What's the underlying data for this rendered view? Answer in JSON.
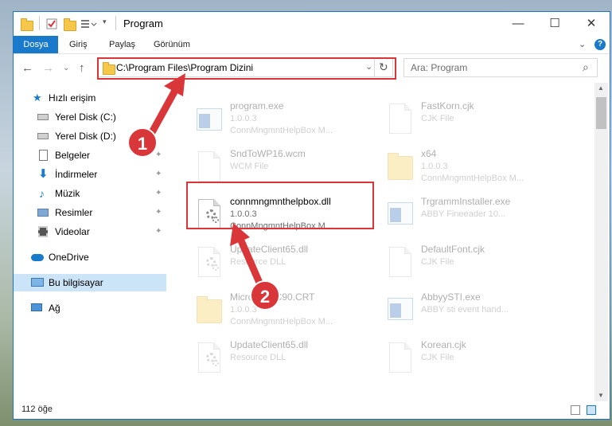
{
  "window": {
    "title": "Program",
    "controls": {
      "minimize": "—",
      "maximize": "☐",
      "close": "✕"
    }
  },
  "ribbon": {
    "tabs": [
      "Dosya",
      "Giriş",
      "Paylaş",
      "Görünüm"
    ],
    "expand": "⌄",
    "help": "?"
  },
  "navigation": {
    "back": "←",
    "forward": "→",
    "recent": "⌄",
    "up": "↑"
  },
  "address_bar": {
    "path": "C:\\Program Files\\Program Dizini",
    "dropdown": "⌄",
    "refresh": "↻"
  },
  "search": {
    "placeholder": "Ara: Program",
    "icon": "⌕"
  },
  "sidebar": {
    "items": [
      {
        "label": "Hızlı erişim",
        "icon": "star-icon"
      },
      {
        "label": "Yerel Disk (C:)",
        "icon": "drive-icon",
        "pinned": true
      },
      {
        "label": "Yerel Disk (D:)",
        "icon": "drive-icon",
        "pinned": true
      },
      {
        "label": "Belgeler",
        "icon": "documents-icon",
        "pinned": true
      },
      {
        "label": "İndirmeler",
        "icon": "download-icon",
        "pinned": true
      },
      {
        "label": "Müzik",
        "icon": "music-icon",
        "pinned": true
      },
      {
        "label": "Resimler",
        "icon": "pictures-icon",
        "pinned": true
      },
      {
        "label": "Videolar",
        "icon": "videos-icon",
        "pinned": true
      },
      {
        "label": "OneDrive",
        "icon": "cloud-icon"
      },
      {
        "label": "Bu bilgisayar",
        "icon": "computer-icon",
        "selected": true
      },
      {
        "label": "Ağ",
        "icon": "network-icon"
      }
    ],
    "pin_glyph": "📌"
  },
  "files": [
    {
      "name": "program.exe",
      "line2": "1.0.0.3",
      "line3": "ConnMngmntHelpBox M...",
      "type": "exe",
      "faded": true
    },
    {
      "name": "FastKorn.cjk",
      "line2": "CJK File",
      "line3": "",
      "type": "doc",
      "faded": true
    },
    {
      "name": "SndToWP16.wcm",
      "line2": "WCM File",
      "line3": "",
      "type": "doc",
      "faded": true
    },
    {
      "name": "x64",
      "line2": "1.0.0.3",
      "line3": "ConnMngmntHelpBox M...",
      "type": "folder",
      "faded": true
    },
    {
      "name": "connmngmnthelpbox.dll",
      "line2": "1.0.0.3",
      "line3": "ConnMngmntHelpBox M...",
      "type": "dll",
      "faded": false
    },
    {
      "name": "TrgrammInstaller.exe",
      "line2": "ABBY Fineeader 10...",
      "line3": "",
      "type": "app",
      "faded": true
    },
    {
      "name": "UpdateClient65.dll",
      "line2": "Resource DLL",
      "line3": "",
      "type": "dll",
      "faded": true
    },
    {
      "name": "DefaultFont.cjk",
      "line2": "CJK File",
      "line3": "",
      "type": "doc",
      "faded": true
    },
    {
      "name": "MicrosoftVC90.CRT",
      "line2": "1.0.0.3",
      "line3": "ConnMngmntHelpBox M...",
      "type": "folder",
      "faded": true
    },
    {
      "name": "AbbyySTI.exe",
      "line2": "ABBY sti event hand...",
      "line3": "",
      "type": "app",
      "faded": true
    },
    {
      "name": "UpdateClient65.dll",
      "line2": "Resource DLL",
      "line3": "",
      "type": "dll",
      "faded": true
    },
    {
      "name": "Korean.cjk",
      "line2": "CJK File",
      "line3": "",
      "type": "doc",
      "faded": true
    }
  ],
  "status": {
    "count": "112 öğe"
  },
  "annotations": {
    "step1": "1",
    "step2": "2",
    "highlight_color": "#d9363a"
  },
  "colors": {
    "accent": "#1979ca",
    "selection": "#cce4f7"
  }
}
